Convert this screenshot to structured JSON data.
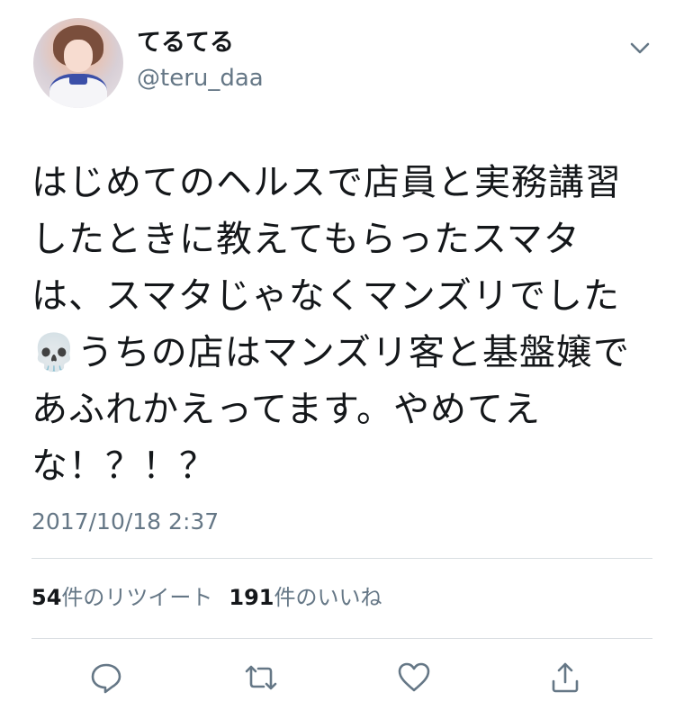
{
  "user": {
    "display_name": "てるてる",
    "handle": "@teru_daa"
  },
  "tweet": {
    "text": "はじめてのヘルスで店員と実務講習したときに教えてもらったスマタは、スマタじゃなくマンズリでした💀うちの店はマンズリ客と基盤嬢であふれかえってます。やめてえな！？！？",
    "timestamp": "2017/10/18 2:37"
  },
  "stats": {
    "retweets_count": "54",
    "retweets_label": "件のリツイート",
    "likes_count": "191",
    "likes_label": "件のいいね"
  },
  "icons": {
    "menu": "chevron-down-icon",
    "reply": "reply-icon",
    "retweet": "retweet-icon",
    "like": "heart-icon",
    "share": "share-icon"
  },
  "colors": {
    "text": "#14171a",
    "secondary": "#657786",
    "divider": "#d9dee2"
  }
}
